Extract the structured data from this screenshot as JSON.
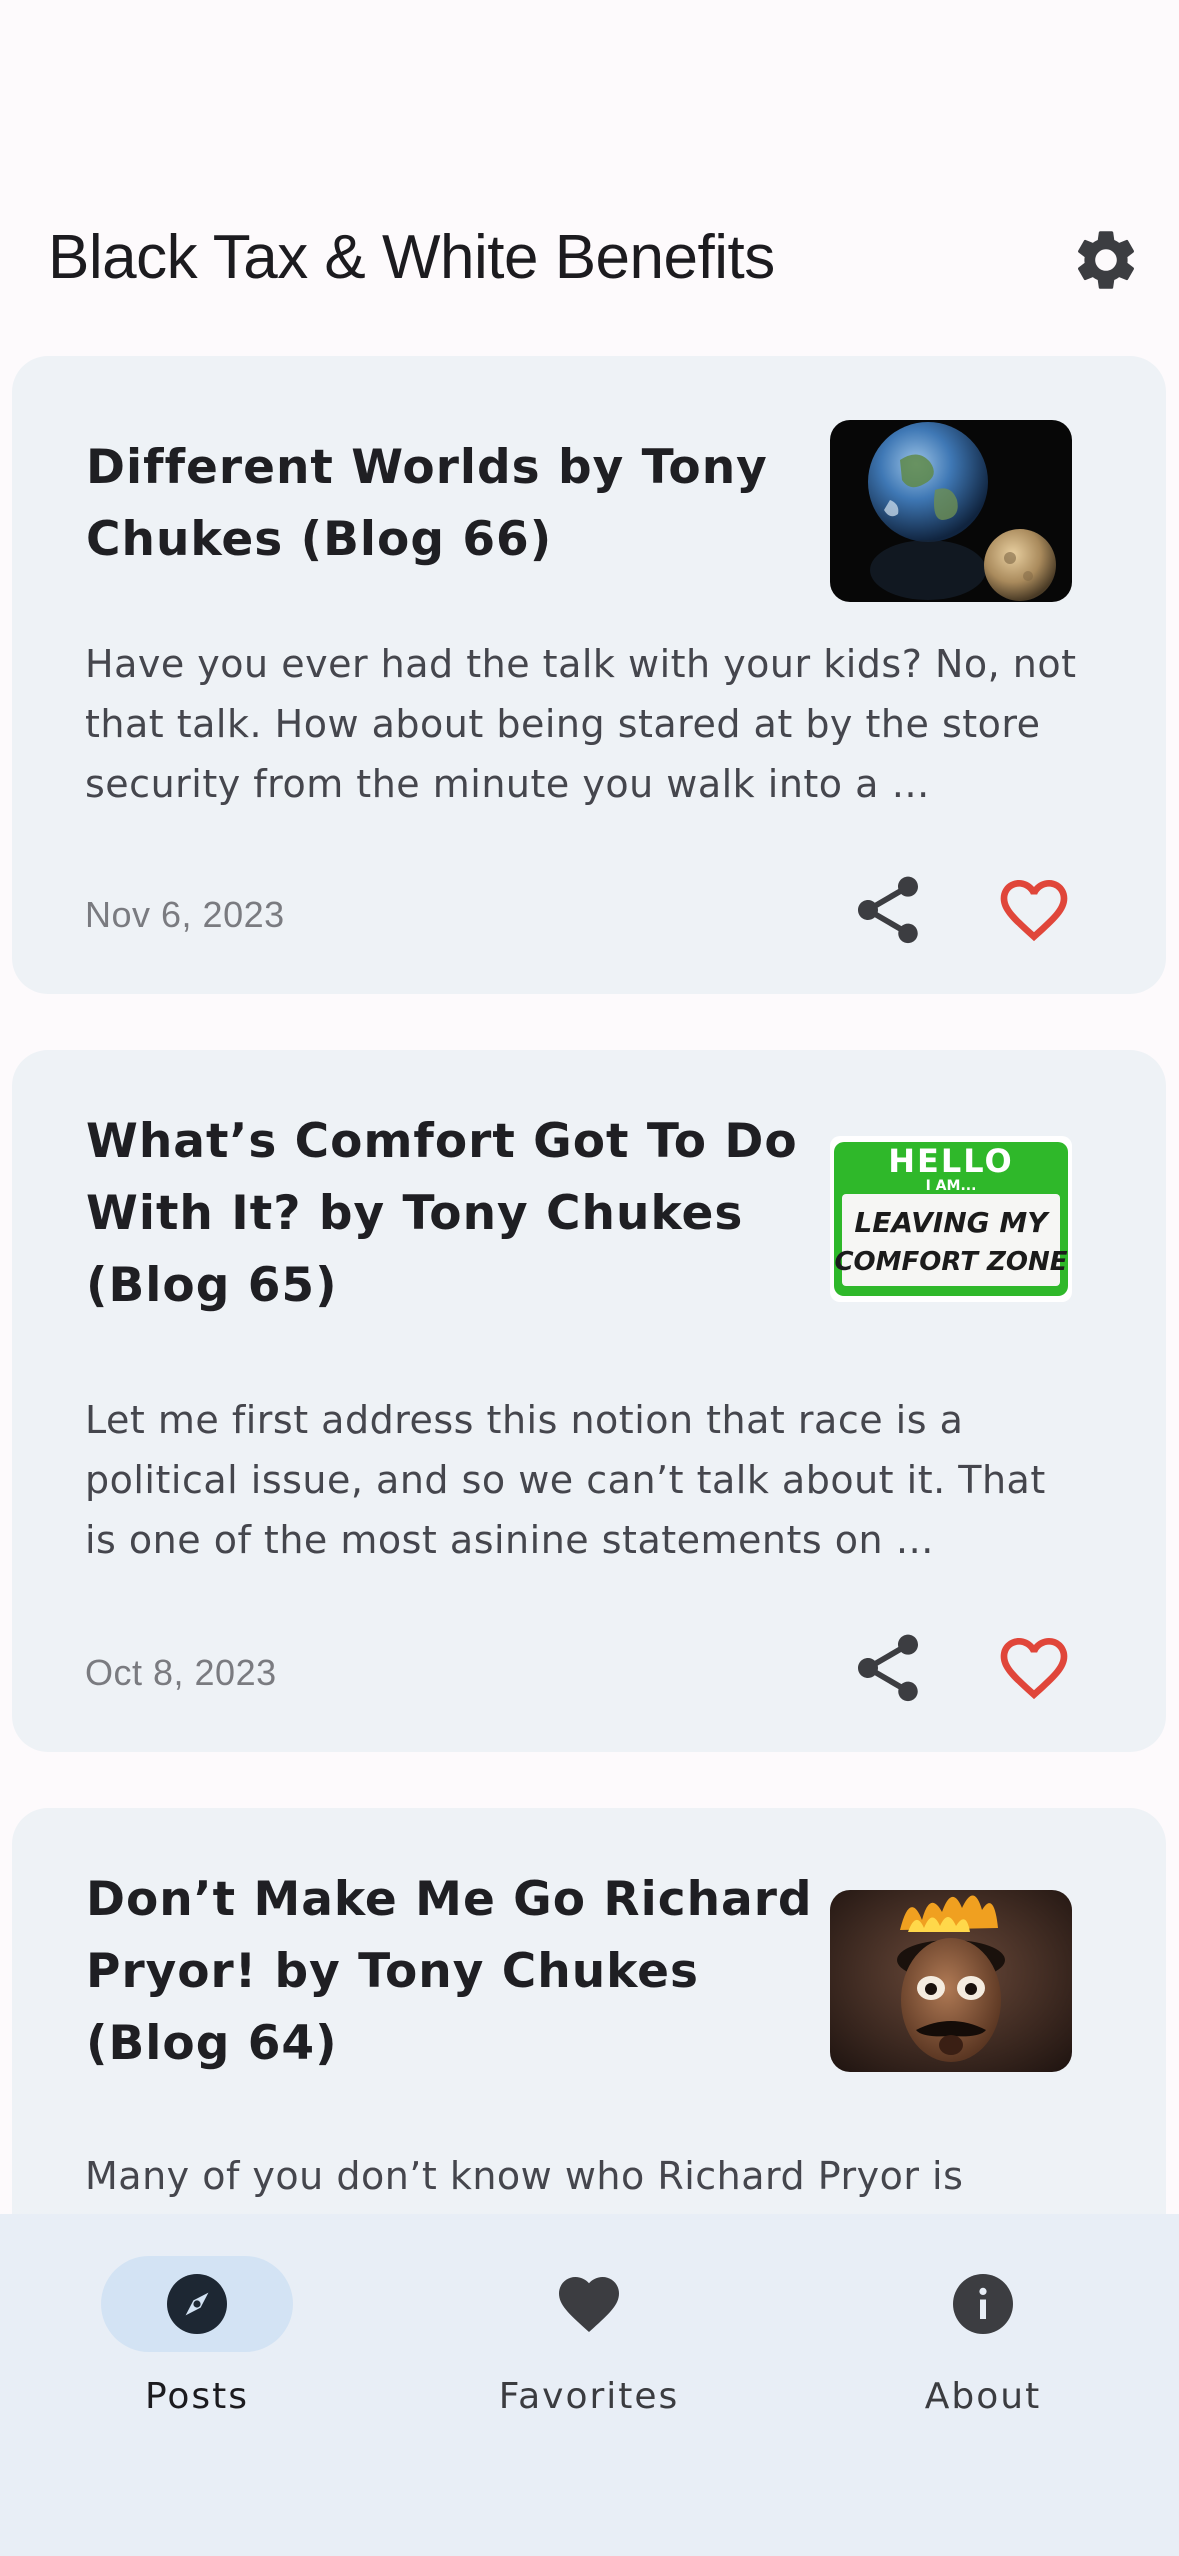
{
  "app": {
    "title": "Black Tax & White Benefits"
  },
  "colors": {
    "background": "#fdfafc",
    "card": "#eef2f6",
    "favorite_red": "#e0463a",
    "nav_background": "#e8eef6",
    "nav_active_pill": "#d3e3f4"
  },
  "posts": [
    {
      "title": "Different Worlds by Tony Chukes (Blog 66)",
      "excerpt": "Have you ever had the talk with your kids?  No, not that talk.  How about being stared at by the store security from the minute you walk into a …",
      "date": "Nov 6, 2023",
      "thumbnail": "earth-and-moon-image",
      "share_icon": "share-icon",
      "favorite_icon": "heart-outline-icon"
    },
    {
      "title": "What’s Comfort Got To Do With It? by Tony Chukes (Blog 65)",
      "excerpt": "Let me first address this notion that race is a political issue, and so we can’t talk about it.  That is one of the most asinine statements on …",
      "date": "Oct 8, 2023",
      "thumbnail": "name-tag-image",
      "thumbnail_text": {
        "hello": "HELLO",
        "iam": "I AM...",
        "line1": "LEAVING MY",
        "line2": "COMFORT ZONE"
      },
      "share_icon": "share-icon",
      "favorite_icon": "heart-outline-icon"
    },
    {
      "title": "Don’t Make Me Go Richard Pryor! by Tony Chukes (Blog 64)",
      "excerpt": "Many of you don’t know who Richard Pryor is",
      "thumbnail": "caricature-image"
    }
  ],
  "nav": {
    "items": [
      {
        "label": "Posts",
        "icon": "compass-icon",
        "active": true
      },
      {
        "label": "Favorites",
        "icon": "heart-icon",
        "active": false
      },
      {
        "label": "About",
        "icon": "info-icon",
        "active": false
      }
    ]
  }
}
